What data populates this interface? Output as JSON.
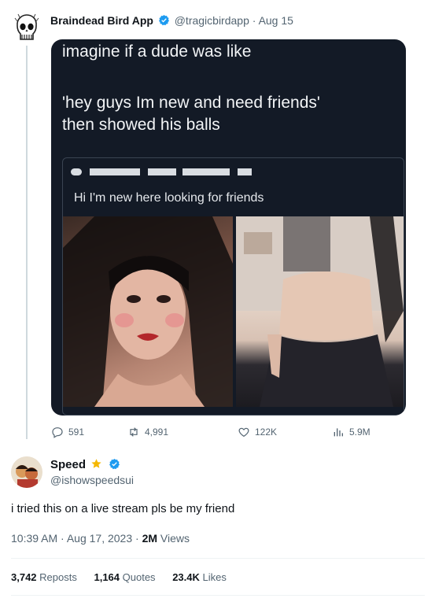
{
  "original": {
    "author_name": "Braindead Bird App",
    "handle": "@tragicbirdapp",
    "separator": "·",
    "date": "Aug 15",
    "image": {
      "line1": "imagine if a dude was like",
      "line2": "'hey guys Im new and need friends'",
      "line3": "then showed his balls",
      "embedded_text": "Hi I'm new here looking for friends"
    },
    "actions": {
      "replies": "591",
      "reposts": "4,991",
      "likes": "122K",
      "views": "5.9M"
    }
  },
  "reply": {
    "author_name": "Speed",
    "handle": "@ishowspeedsui",
    "text": "i tried this on a live stream pls be my friend",
    "timestamp": "10:39 AM · Aug 17, 2023 · ",
    "views_count": "2M",
    "views_label": " Views",
    "stats": {
      "reposts_count": "3,742",
      "reposts_label": " Reposts",
      "quotes_count": "1,164",
      "quotes_label": " Quotes",
      "likes_count": "23.4K",
      "likes_label": " Likes"
    }
  },
  "colors": {
    "verified": "#1d9bf0",
    "star": "#f5b800",
    "muted": "#536471"
  },
  "icons": [
    "reply-icon",
    "repost-icon",
    "like-icon",
    "views-icon",
    "verified-badge-icon",
    "star-icon"
  ]
}
